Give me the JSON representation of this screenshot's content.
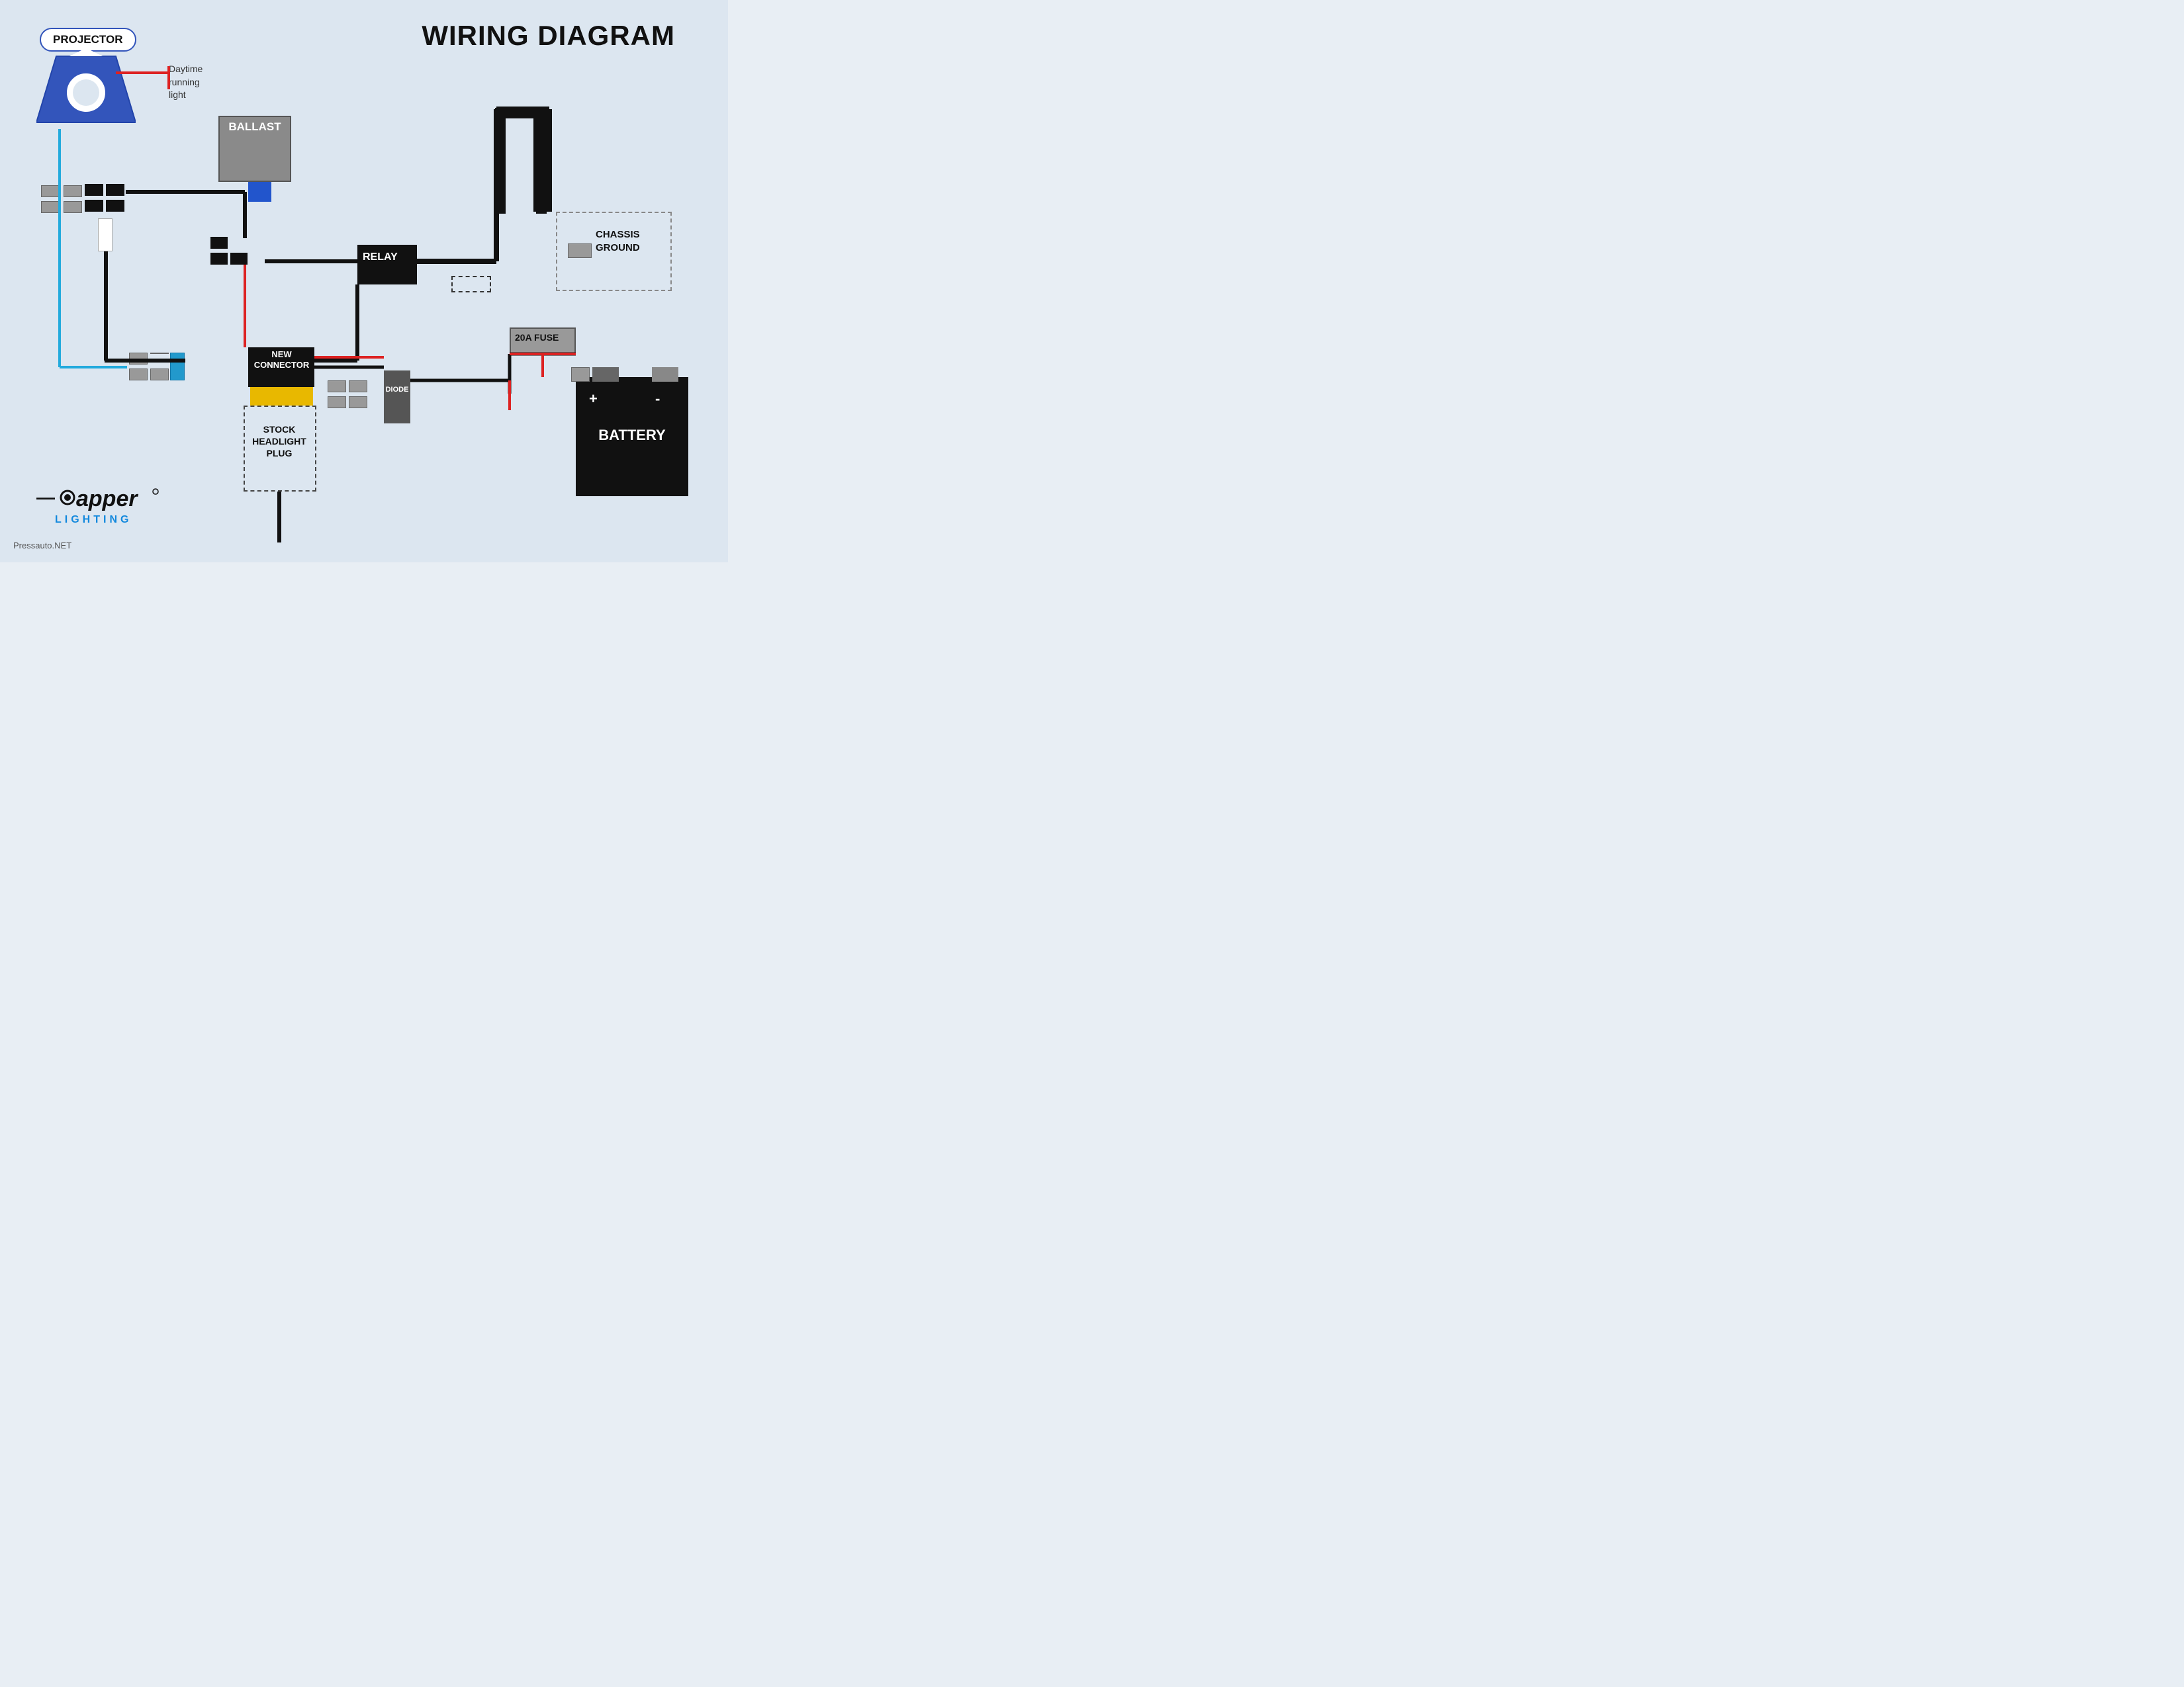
{
  "title": "WIRING DIAGRAM",
  "components": {
    "projector": {
      "label": "PROJECTOR"
    },
    "ballast": {
      "label": "BALLAST"
    },
    "relay": {
      "label": "RELAY"
    },
    "fuse": {
      "label": "20A FUSE"
    },
    "chassis_ground": {
      "label": "CHASSIS\nGROUND",
      "line1": "CHASSIS",
      "line2": "GROUND"
    },
    "battery": {
      "label": "BATTERY",
      "plus": "+",
      "minus": "-"
    },
    "new_connector": {
      "label": "NEW\nCONNECTOR",
      "line1": "NEW",
      "line2": "CONNECTOR"
    },
    "stock_headlight_plug": {
      "label": "STOCK\nHEADLIGHT\nPLUG",
      "line1": "STOCK",
      "line2": "HEADLIGHT",
      "line3": "PLUG"
    },
    "diode": {
      "label": "DIODE"
    },
    "drl": {
      "label": "Daytime\nrunning\nlight",
      "line1": "Daytime",
      "line2": "running",
      "line3": "light"
    }
  },
  "logo": {
    "name": "Dapper Lighting",
    "lighting_text": "LIGHTING",
    "url": "Pressauto.NET"
  },
  "colors": {
    "background": "#dce6f0",
    "projector_border": "#3355bb",
    "red_wire": "#dd2222",
    "blue_wire": "#22aadd",
    "black_wire": "#111111",
    "ballast_bg": "#8a8a8a",
    "relay_bg": "#111111",
    "battery_bg": "#111111",
    "yellow_pins": "#e8b800",
    "chassis_dashed": "#888888"
  }
}
